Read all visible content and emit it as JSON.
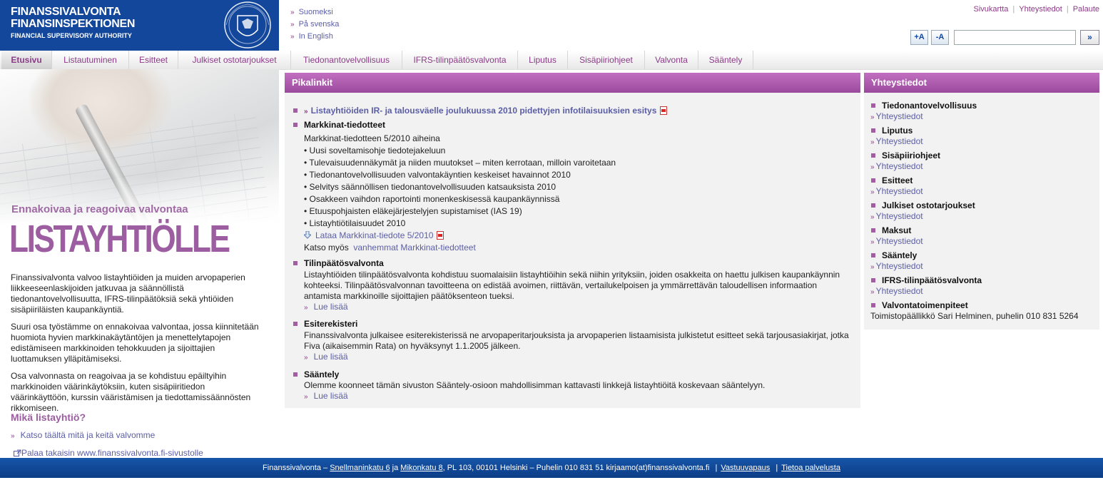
{
  "header": {
    "logo_line1": "FINANSSIVALVONTA",
    "logo_line2": "FINANSINSPEKTIONEN",
    "logo_line3": "FINANCIAL SUPERVISORY AUTHORITY",
    "languages": [
      "Suomeksi",
      "På svenska",
      "In English"
    ],
    "top_links": [
      "Sivukartta",
      "Yhteystiedot",
      "Palaute"
    ],
    "font_increase": "+A",
    "font_decrease": "-A",
    "search_value": "",
    "search_go": "»"
  },
  "nav": [
    "Etusivu",
    "Listautuminen",
    "Esitteet",
    "Julkiset ostotarjoukset",
    "Tiedonantovelvollisuus",
    "IFRS-tilinpäätösvalvonta",
    "Liputus",
    "Sisäpiiriohjeet",
    "Valvonta",
    "Sääntely"
  ],
  "left": {
    "hero_sub": "Ennakoivaa ja reagoivaa valvontaa",
    "hero_big": "LISTAYHTIÖLLE",
    "paragraphs": [
      "Finanssivalvonta valvoo listayhtiöiden ja muiden arvopaperien liikkeeseenlaskijoiden jatkuvaa ja säännöllistä tiedonantovelvollisuutta, IFRS-tilinpäätöksiä sekä yhtiöiden sisäpiiriläisten kaupankäyntiä.",
      "Suuri osa työstämme on ennakoivaa valvontaa, jossa kiinnitetään huomiota hyvien markkinakäytäntöjen ja menettelytapojen edistämiseen markkinoiden tehokkuuden ja sijoittajien luottamuksen ylläpitämiseksi.",
      "Osa valvonnasta on reagoivaa ja se kohdistuu epäiltyihin markkinoiden väärinkäytöksiin, kuten sisäpiiritiedon väärinkäyttöön, kurssin vääristämisen ja tiedottamissäännösten rikkomiseen."
    ],
    "mika_heading": "Mikä listayhtiö?",
    "katso_link": "Katso täältä mitä ja keitä valvomme",
    "palaa_link": "Palaa takaisin www.finanssivalvonta.fi-sivustolle"
  },
  "pikalinkit": {
    "title": "Pikalinkit",
    "top_link": "Listayhtiöiden IR- ja talousväelle joulukuussa 2010 pidettyjen infotilaisuuksien esitys",
    "markkinat": {
      "title": "Markkinat-tiedotteet",
      "intro": "Markkinat-tiedotteen 5/2010 aiheina",
      "items": [
        "• Uusi soveltamisohje tiedotejakeluun",
        "• Tulevaisuudennäkymät ja niiden muutokset – miten kerrotaan, milloin varoitetaan",
        "• Tiedonantovelvollisuuden valvontakäyntien keskeiset havainnot 2010",
        "• Selvitys säännöllisen tiedonantovelvollisuuden katsauksista 2010",
        "• Osakkeen vaihdon raportointi monenkeskisessä kaupankäynnissä",
        "• Etuuspohjaisten eläkejärjestelyjen supistamiset (IAS 19)",
        "• Listayhtiötilaisuudet 2010"
      ],
      "download": "Lataa Markkinat-tiedote 5/2010",
      "see_also_label": "Katso myös",
      "see_also_link": "vanhemmat Markkinat-tiedotteet"
    },
    "tilinpaatos": {
      "title": "Tilinpäätösvalvonta",
      "text": "Listayhtiöiden tilinpäätösvalvonta kohdistuu suomalaisiin listayhtiöihin sekä niihin yrityksiin, joiden osakkeita on haettu julkisen kaupankäynnin kohteeksi. Tilinpäätösvalvonnan tavoitteena on edistää avoimen, riittävän, vertailukelpoisen ja ymmärrettävän taloudellisen informaation antamista markkinoille sijoittajien päätöksenteon tueksi.",
      "more": "Lue lisää"
    },
    "esiterekisteri": {
      "title": "Esiterekisteri",
      "text": "Finanssivalvonta julkaisee esiterekisterissä ne arvopaperitarjouksista ja arvopaperien listaamisista julkistetut esitteet sekä tarjousasiakirjat, jotka Fiva (aikaisemmin Rata) on hyväksynyt 1.1.2005 jälkeen.",
      "more": "Lue lisää"
    },
    "saantely": {
      "title": "Sääntely",
      "text": "Olemme koonneet tämän sivuston Sääntely-osioon mahdollisimman kattavasti linkkejä listayhtiöitä koskevaan sääntelyyn.",
      "more": "Lue lisää"
    }
  },
  "yhteystiedot": {
    "title": "Yhteystiedot",
    "items": [
      {
        "cat": "Tiedonantovelvollisuus",
        "link": "Yhteystiedot"
      },
      {
        "cat": "Liputus",
        "link": "Yhteystiedot"
      },
      {
        "cat": "Sisäpiiriohjeet",
        "link": "Yhteystiedot"
      },
      {
        "cat": "Esitteet",
        "link": "Yhteystiedot"
      },
      {
        "cat": "Julkiset ostotarjoukset",
        "link": "Yhteystiedot"
      },
      {
        "cat": "Maksut",
        "link": "Yhteystiedot"
      },
      {
        "cat": "Sääntely",
        "link": "Yhteystiedot"
      },
      {
        "cat": "IFRS-tilinpäätösvalvonta",
        "link": "Yhteystiedot"
      }
    ],
    "last_cat": "Valvontatoimenpiteet",
    "last_text": "Toimistopäällikkö Sari Helminen, puhelin 010 831 5264"
  },
  "footer": {
    "prefix": "Finanssivalvonta –",
    "addr1": "Snellmaninkatu 6",
    "and": "ja",
    "addr2": "Mikonkatu 8",
    "rest": ", PL 103, 00101 Helsinki – Puhelin 010 831 51   kirjaamo(at)finanssivalvonta.fi",
    "link1": "Vastuuvapaus",
    "link2": "Tietoa palvelusta"
  },
  "colors": {
    "brand_blue": "#13479b",
    "accent_purple": "#9c5ea0"
  }
}
